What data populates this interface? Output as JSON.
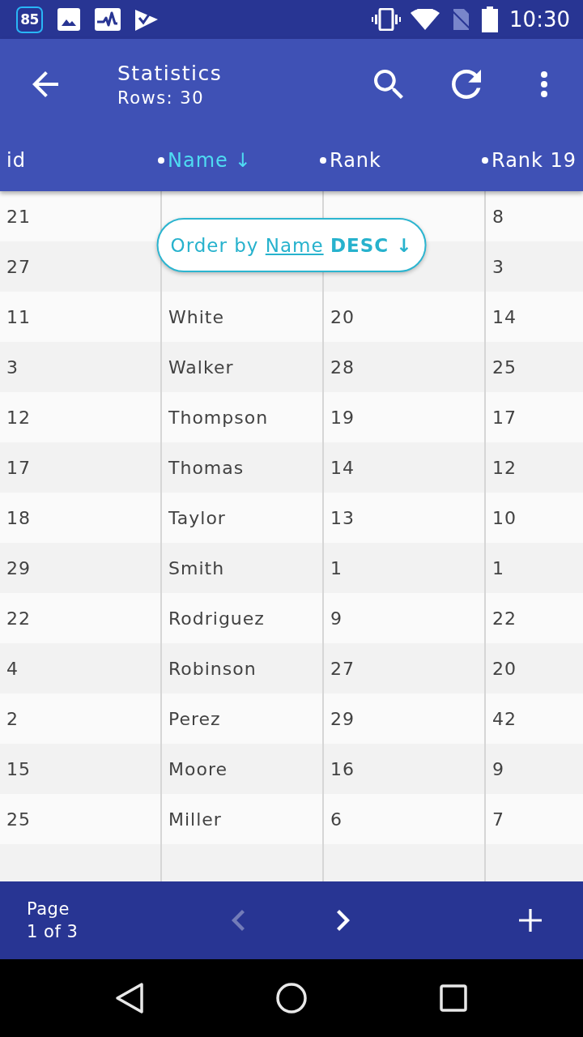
{
  "status_bar": {
    "notification_count": "85",
    "time": "10:30"
  },
  "toolbar": {
    "title": "Statistics",
    "subtitle": "Rows: 30"
  },
  "table": {
    "columns": [
      {
        "label": "id",
        "sortable": false,
        "selected": false
      },
      {
        "label": "Name",
        "sortable": true,
        "selected": true,
        "sort_arrow": "↓"
      },
      {
        "label": "Rank",
        "sortable": true,
        "selected": false
      },
      {
        "label": "Rank 19",
        "sortable": true,
        "selected": false
      }
    ],
    "rows": [
      [
        "21",
        null,
        null,
        "8"
      ],
      [
        "27",
        null,
        null,
        "3"
      ],
      [
        "11",
        "White",
        "20",
        "14"
      ],
      [
        "3",
        "Walker",
        "28",
        "25"
      ],
      [
        "12",
        "Thompson",
        "19",
        "17"
      ],
      [
        "17",
        "Thomas",
        "14",
        "12"
      ],
      [
        "18",
        "Taylor",
        "13",
        "10"
      ],
      [
        "29",
        "Smith",
        "1",
        "1"
      ],
      [
        "22",
        "Rodriguez",
        "9",
        "22"
      ],
      [
        "4",
        "Robinson",
        "27",
        "20"
      ],
      [
        "2",
        "Perez",
        "29",
        "42"
      ],
      [
        "15",
        "Moore",
        "16",
        "9"
      ],
      [
        "25",
        "Miller",
        "6",
        "7"
      ]
    ]
  },
  "toast": {
    "prefix": "Order by",
    "link": "Name",
    "suffix": "**DESC ↓**"
  },
  "pager": {
    "label": "Page",
    "value": "1 of 3",
    "buttons": [
      {
        "kind": "prev",
        "disabled": true
      },
      {
        "kind": "next",
        "disabled": false
      },
      {
        "kind": "add",
        "disabled": false
      }
    ]
  }
}
